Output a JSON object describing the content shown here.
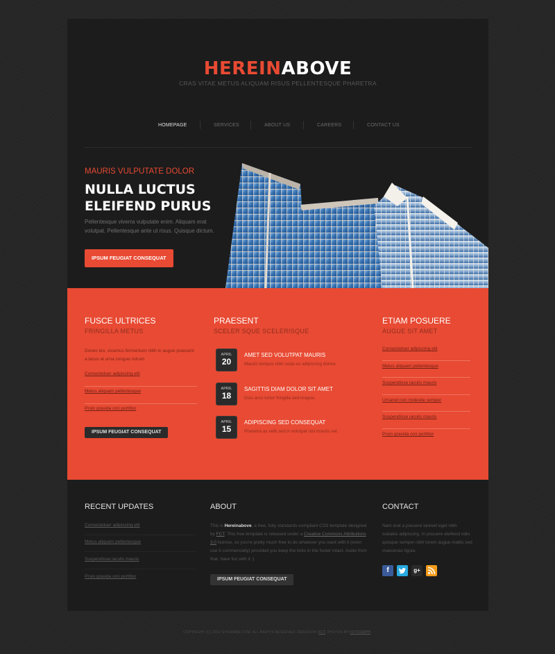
{
  "header": {
    "logo_part1": "HEREIN",
    "logo_part2": "ABOVE",
    "tagline": "CRAS VITAE METUS ALIQUAM RISUS PELLENTESQUE PHARETRA"
  },
  "nav": {
    "items": [
      {
        "label": "HOMEPAGE",
        "active": true
      },
      {
        "label": "SERVICES",
        "active": false
      },
      {
        "label": "ABOUT US",
        "active": false
      },
      {
        "label": "CAREERS",
        "active": false
      },
      {
        "label": "CONTACT US",
        "active": false
      }
    ]
  },
  "hero": {
    "kicker": "MAURIS VULPUTATE DOLOR",
    "title_line1": "NULLA LUCTUS",
    "title_line2": "ELEIFEND PURUS",
    "text": "Pellentesque viverra vulputate enim. Aliquam erat volutpat. Pellentesque ante ut risus. Quisque dictum.",
    "button": "IPSUM FEUGIAT CONSEQUAT"
  },
  "band": {
    "col1": {
      "title": "FUSCE ULTRICES",
      "subtitle": "FRINGILLA METUS",
      "text": "Donec leo, vivamus fermentum nibh in augue praesent a lacus at urna congue rutrum",
      "links": [
        "Consectetuer adipiscing elit",
        "Metus aliquam pellentesque",
        "Proin gravida orci porttitor"
      ],
      "button": "IPSUM FEUGIAT CONSEQUAT"
    },
    "col2": {
      "title": "PRAESENT",
      "subtitle": "SCELER SQUE SCELERISQUE",
      "events": [
        {
          "month": "APRIL",
          "day": "20",
          "title": "AMET SED VOLUTPAT MAURIS",
          "text": "Mauris tempus nibh soda es adipiscing dolore."
        },
        {
          "month": "APRIL",
          "day": "18",
          "title": "SAGITTIS DIAM DOLOR SIT AMET",
          "text": "Duis arcu tortor fringilla sed magna."
        },
        {
          "month": "APRIL",
          "day": "15",
          "title": "ADIPISCING SED CONSEQUAT",
          "text": "Pharetra as velit sed in volutpat nisl mauris vel."
        }
      ]
    },
    "col3": {
      "title": "ETIAM POSUERE",
      "subtitle": "AUGUE SIT AMET",
      "links": [
        "Consectetuer adipiscing elit",
        "Metus aliquam pellentesque",
        "Suspendisse iaculis mauris",
        "Urnanet non molestie semper",
        "Suspendisse iaculis mauris",
        "Proin gravida orci porttitor"
      ]
    }
  },
  "footer": {
    "recent": {
      "title": "RECENT UPDATES",
      "links": [
        "Consectetuer adipiscing elit",
        "Metus aliquam pellentesque",
        "Suspendisse iaculis mauris",
        "Proin gravida orci porttitor"
      ]
    },
    "about": {
      "title": "ABOUT",
      "text_pre": "This is ",
      "brand": "Hereinabove",
      "text_mid1": ", a free, fully standards-compliant CSS template designed by ",
      "fct": "FCT",
      "text_mid2": ". This free template is released under a ",
      "license": "Creative Commons Attributions 3.0",
      "text_post": " license, so you're pretty much free to do whatever you want with it (even use it commercially) provided you keep the links in the footer intact. Aside from that, have fun with it :)",
      "button": "IPSUM FEUGIAT CONSEQUAT"
    },
    "contact": {
      "title": "CONTACT",
      "text": "Nam erat a posuere laoreet eget nibh sodales adipiscing. In posuere eleifend odio quisque semper nibh lorem augue mattis sed maecenas ligula."
    },
    "social_icons": [
      "facebook-icon",
      "twitter-icon",
      "google-plus-icon",
      "rss-icon"
    ]
  },
  "copyright": {
    "text": "COPYRIGHT (C) 2013 SITENAME.COM. ALL RIGHTS RESERVED. DESIGN BY ",
    "fct": "FCT",
    "photos": ". PHOTOS BY ",
    "fotogrph": "FOTOGRPH",
    "end": "."
  },
  "colors": {
    "accent": "#e84a33",
    "page_bg": "#262626",
    "wrapper_bg": "#1c1c1c"
  }
}
